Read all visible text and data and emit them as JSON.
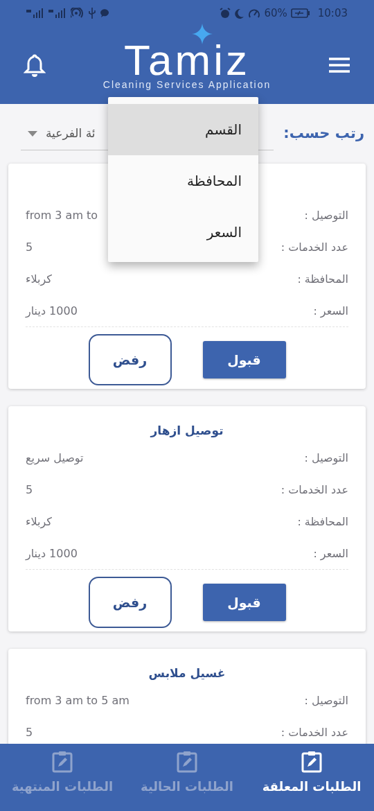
{
  "status_bar": {
    "battery": "60%",
    "time": "10:03"
  },
  "header": {
    "logo": "Tamiz",
    "subtitle": "Cleaning Services Application"
  },
  "sort": {
    "label": "رتب حسب:",
    "value": "ئة الفرعية"
  },
  "sort_menu": [
    {
      "label": "القسم",
      "selected": true
    },
    {
      "label": "المحافظة",
      "selected": false
    },
    {
      "label": "السعر",
      "selected": false
    }
  ],
  "orders": [
    {
      "rows": [
        {
          "label": "التوصيل :",
          "value": "from 3 am to"
        },
        {
          "label": "عدد الخدمات :",
          "value": "5"
        },
        {
          "label": "المحافظة :",
          "value": "كربلاء"
        },
        {
          "label": "السعر :",
          "value": "1000 دينار"
        }
      ],
      "accept": "قبول",
      "reject": "رفض"
    },
    {
      "title": "توصيل ازهار",
      "rows": [
        {
          "label": "التوصيل :",
          "value": "توصيل سريع"
        },
        {
          "label": "عدد الخدمات :",
          "value": "5"
        },
        {
          "label": "المحافظة :",
          "value": "كربلاء"
        },
        {
          "label": "السعر :",
          "value": "1000 دينار"
        }
      ],
      "accept": "قبول",
      "reject": "رفض"
    },
    {
      "title": "غسيل ملابس",
      "rows": [
        {
          "label": "التوصيل :",
          "value": "from 3 am to 5 am"
        },
        {
          "label": "عدد الخدمات :",
          "value": "5"
        }
      ]
    }
  ],
  "bottom_nav": [
    {
      "label": "الطلبات المعلقة",
      "selected": true
    },
    {
      "label": "الطلبات الحالية",
      "selected": false
    },
    {
      "label": "الطلبات المنتهية",
      "selected": false
    }
  ]
}
